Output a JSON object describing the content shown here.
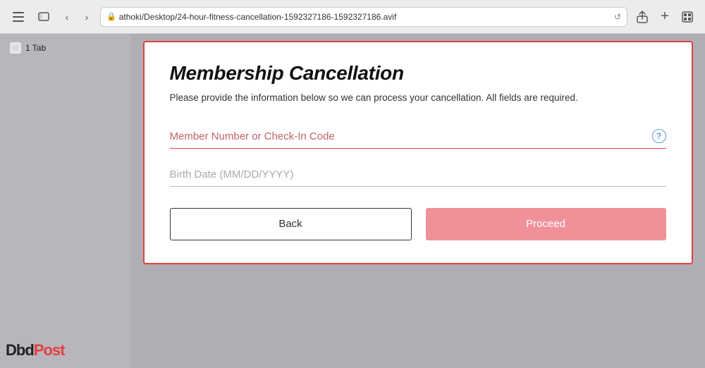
{
  "browser": {
    "url": "athoki/Desktop/24-hour-fitness-cancellation-1592327186-1592327186.avif",
    "tabs_count": "1 Tab"
  },
  "sidebar": {
    "tab_label": "1 Tab"
  },
  "card": {
    "title": "Membership Cancellation",
    "subtitle": "Please provide the information below so we can process your cancellation. All fields are required.",
    "member_number_placeholder": "Member Number or Check-In Code",
    "birth_date_placeholder": "Birth Date (MM/DD/YYYY)",
    "back_label": "Back",
    "proceed_label": "Proceed"
  },
  "watermark": {
    "dbd": "Dbd",
    "post": "Post"
  }
}
